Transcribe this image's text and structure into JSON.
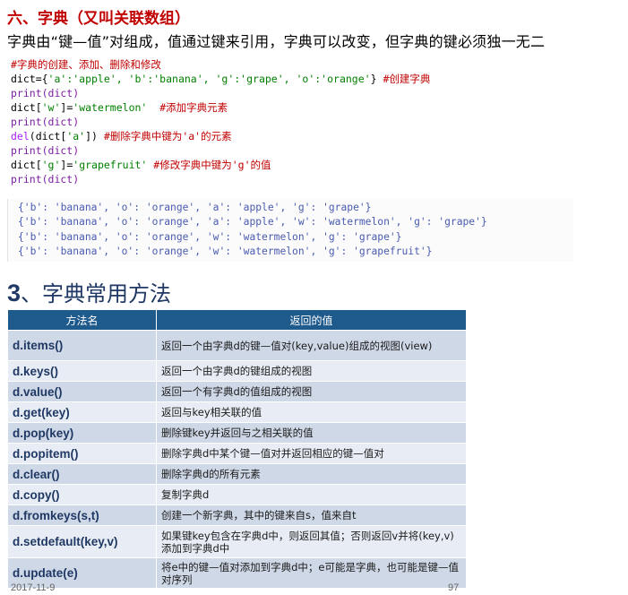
{
  "section6_title": "六、字典（又叫关联数组）",
  "intro": "字典由“键—值”对组成，值通过键来引用，字典可以改变，但字典的键必须独一无二",
  "code": {
    "comment": "#字典的创建、添加、删除和修改",
    "l1_head": "dict={",
    "l1_items": "'a':'apple', 'b':'banana', 'g':'grape', 'o':'orange'",
    "l1_tail": "}",
    "l1_comment": "#创建字典",
    "print": "print(dict)",
    "l3_head": "dict[",
    "l3_key": "'w'",
    "l3_mid": "]=",
    "l3_val": "'watermelon'",
    "l3_comment": "#添加字典元素",
    "l5_kw": "del",
    "l5_head": "(dict[",
    "l5_key": "'a'",
    "l5_tail": "])",
    "l5_comment": "#删除字典中键为'a'的元素",
    "l7_key": "'g'",
    "l7_val": "'grapefruit'",
    "l7_comment": "#修改字典中键为'g'的值"
  },
  "output_lines": [
    "{'b': 'banana', 'o': 'orange', 'a': 'apple', 'g': 'grape'}",
    "{'b': 'banana', 'o': 'orange', 'a': 'apple', 'w': 'watermelon', 'g': 'grape'}",
    "{'b': 'banana', 'o': 'orange', 'w': 'watermelon', 'g': 'grape'}",
    "{'b': 'banana', 'o': 'orange', 'w': 'watermelon', 'g': 'grapefruit'}"
  ],
  "section3": {
    "num": "3",
    "title": "、字典常用方法"
  },
  "table": {
    "headers": [
      "方法名",
      "返回的值"
    ],
    "rows": [
      {
        "name": "d.items()",
        "desc": "返回一个由字典d的键—值对(key,value)组成的视图(view)"
      },
      {
        "name": "d.keys()",
        "desc": "返回一个由字典d的键组成的视图"
      },
      {
        "name": "d.value()",
        "desc": "返回一个有字典d的值组成的视图"
      },
      {
        "name": "d.get(key)",
        "desc": "返回与key相关联的值"
      },
      {
        "name": "d.pop(key)",
        "desc": "删除键key并返回与之相关联的值"
      },
      {
        "name": "d.popitem()",
        "desc": "删除字典d中某个键—值对并返回相应的键—值对"
      },
      {
        "name": "d.clear()",
        "desc": "删除字典d的所有元素"
      },
      {
        "name": "d.copy()",
        "desc": "复制字典d"
      },
      {
        "name": "d.fromkeys(s,t)",
        "desc": "创建一个新字典，其中的键来自s，值来自t"
      },
      {
        "name": "d.setdefault(key,v)",
        "desc": "如果键key包含在字典d中，则返回其值；否则返回v并将(key,v)添加到字典d中"
      },
      {
        "name": "d.update(e)",
        "desc": "将e中的键—值对添加到字典d中；e可能是字典，也可能是键—值对序列"
      }
    ]
  },
  "footer": {
    "date": "2017-11-9",
    "page": "97"
  }
}
